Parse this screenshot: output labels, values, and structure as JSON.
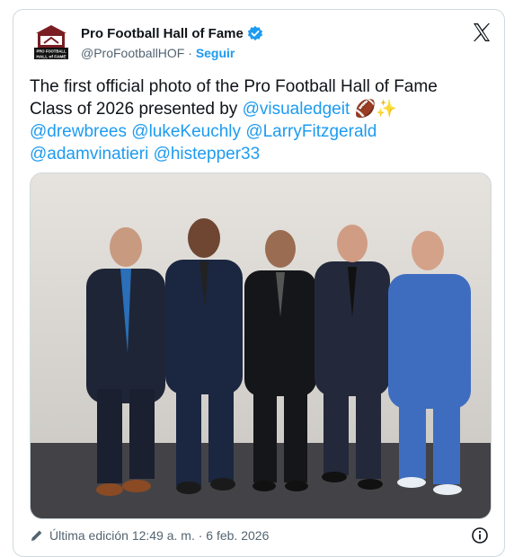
{
  "account": {
    "display_name": "Pro Football Hall of Fame",
    "handle": "@ProFootballHOF",
    "separator": "·",
    "follow_label": "Seguir",
    "logo_text_top": "PRO FOOTBALL",
    "logo_text_bottom": "HALL of FAME"
  },
  "tweet": {
    "text_line1": "The first official photo of the Pro Football Hall of Fame",
    "text_line2_prefix": "Class of 2026 presented by ",
    "mention_visualedgeit": "@visualedgeit",
    "emoji": "🏈✨",
    "mention_drewbrees": "@drewbrees",
    "mention_lukekeuchly": "@lukeKeuchly",
    "mention_larryfitzgerald": "@LarryFitzgerald",
    "mention_adamvinatieri": "@adamvinatieri",
    "mention_histepper33": "@histepper33"
  },
  "footer": {
    "edited_text": "Última edición 12:49 a. m. · 6 feb. 2026"
  },
  "colors": {
    "link": "#1d9bf0",
    "verified": "#1d9bf0",
    "text_primary": "#0f1419",
    "text_secondary": "#536471"
  },
  "icons": [
    "hof-logo-icon",
    "verified-badge-icon",
    "x-logo-icon",
    "pencil-icon",
    "info-icon"
  ]
}
